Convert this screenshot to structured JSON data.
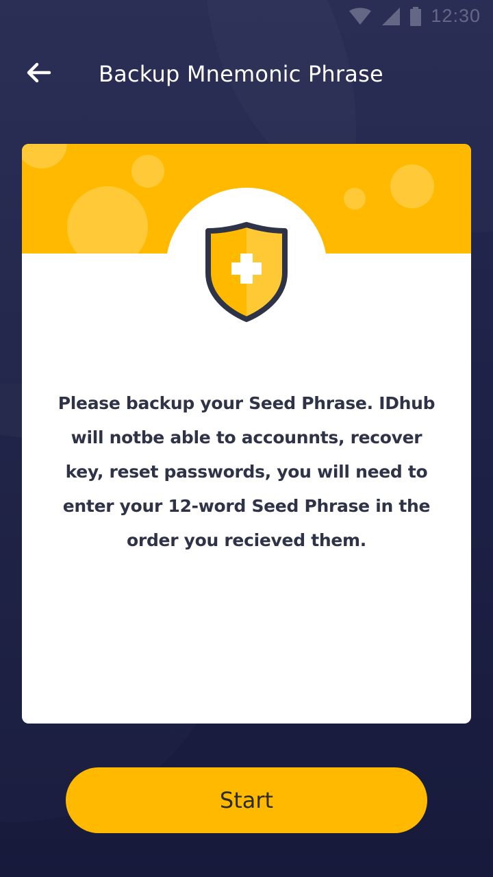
{
  "status_bar": {
    "time": "12:30",
    "icons": [
      "wifi-icon",
      "cell-signal-icon",
      "battery-icon"
    ]
  },
  "header": {
    "back_icon": "back-arrow-icon",
    "title": "Backup Mnemonic Phrase"
  },
  "card": {
    "icon": "shield-plus-icon",
    "message": "Please backup your Seed Phrase. IDhub will notbe able to accounnts, recover key, reset passwords, you will need to enter your 12-word Seed Phrase in the order you recieved them."
  },
  "actions": {
    "start_label": "Start"
  },
  "colors": {
    "background": "#1e2247",
    "accent": "#ffba00",
    "card": "#ffffff",
    "text_dark": "#2f3347",
    "shield_outline": "#2f3347"
  }
}
